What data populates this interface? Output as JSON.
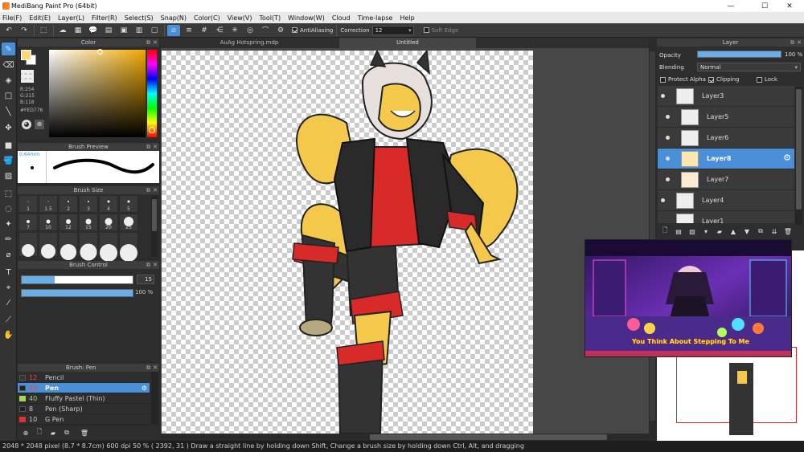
{
  "window": {
    "title": "MediBang Paint Pro (64bit)",
    "minimize": "—",
    "maximize": "☐",
    "close": "✕"
  },
  "menu": [
    "File(F)",
    "Edit(E)",
    "Layer(L)",
    "Filter(R)",
    "Select(S)",
    "Snap(N)",
    "Color(C)",
    "View(V)",
    "Tool(T)",
    "Window(W)",
    "Cloud",
    "Time-lapse",
    "Help"
  ],
  "toolbar": {
    "antialiasing_label": "AntiAliasing",
    "correction_label": "Correction",
    "correction_value": "12",
    "soft_edge_label": "Soft Edge"
  },
  "color_panel": {
    "title": "Color",
    "r": "R:254",
    "g": "G:215",
    "b": "B:118",
    "hex": "#FED776",
    "fg": "#fed776",
    "bg": "#ffffff"
  },
  "brush_preview": {
    "title": "Brush Preview",
    "size": "0.64mm"
  },
  "brush_size": {
    "title": "Brush Size",
    "sizes": [
      "1",
      "1.5",
      "2",
      "3",
      "4",
      "5",
      "7",
      "10",
      "12",
      "15",
      "20",
      "25"
    ]
  },
  "brush_control": {
    "title": "Brush Control",
    "size_value": "15",
    "opacity_value": "100 %",
    "size_fill": 0.3,
    "opacity_fill": 1.0
  },
  "brush_list": {
    "title": "Brush: Pen",
    "items": [
      {
        "num": "12",
        "name": "Pencil",
        "color": "#333333"
      },
      {
        "num": "15",
        "name": "Pen",
        "color": "#222222"
      },
      {
        "num": "40",
        "name": "Fluffy Pastel (Thin)",
        "color": "#a4d65e"
      },
      {
        "num": "8",
        "name": "Pen (Sharp)",
        "color": "#222222"
      },
      {
        "num": "10",
        "name": "G Pen",
        "color": "#e03030"
      }
    ]
  },
  "tabs": [
    "AuAg Hotspring.mdp",
    "Untitled"
  ],
  "layer_panel": {
    "title": "Layer",
    "opacity_label": "Opacity",
    "opacity_value": "100 %",
    "opacity_fill": 1.0,
    "blending_label": "Blending",
    "blending_value": "Normal",
    "protect_alpha": "Protect Alpha",
    "clipping": "Clipping",
    "lock": "Lock",
    "layers": [
      {
        "name": "Layer3"
      },
      {
        "name": "Layer5"
      },
      {
        "name": "Layer6"
      },
      {
        "name": "Layer8"
      },
      {
        "name": "Layer7"
      },
      {
        "name": "Layer4"
      },
      {
        "name": "Layer1"
      }
    ]
  },
  "overlay": {
    "caption": "You Think About Stepping To Me"
  },
  "status": "2048 * 2048 pixel   (8.7 * 8.7cm)   600 dpi   50 %   ( 2392, 31 )   Draw a straight line by holding down Shift, Change a brush size by holding down Ctrl, Alt, and dragging",
  "colors": {
    "accent": "#4a90d9",
    "fox_yellow": "#f4c84a",
    "shirt_red": "#d92a2a",
    "jacket": "#2a2a2a"
  }
}
